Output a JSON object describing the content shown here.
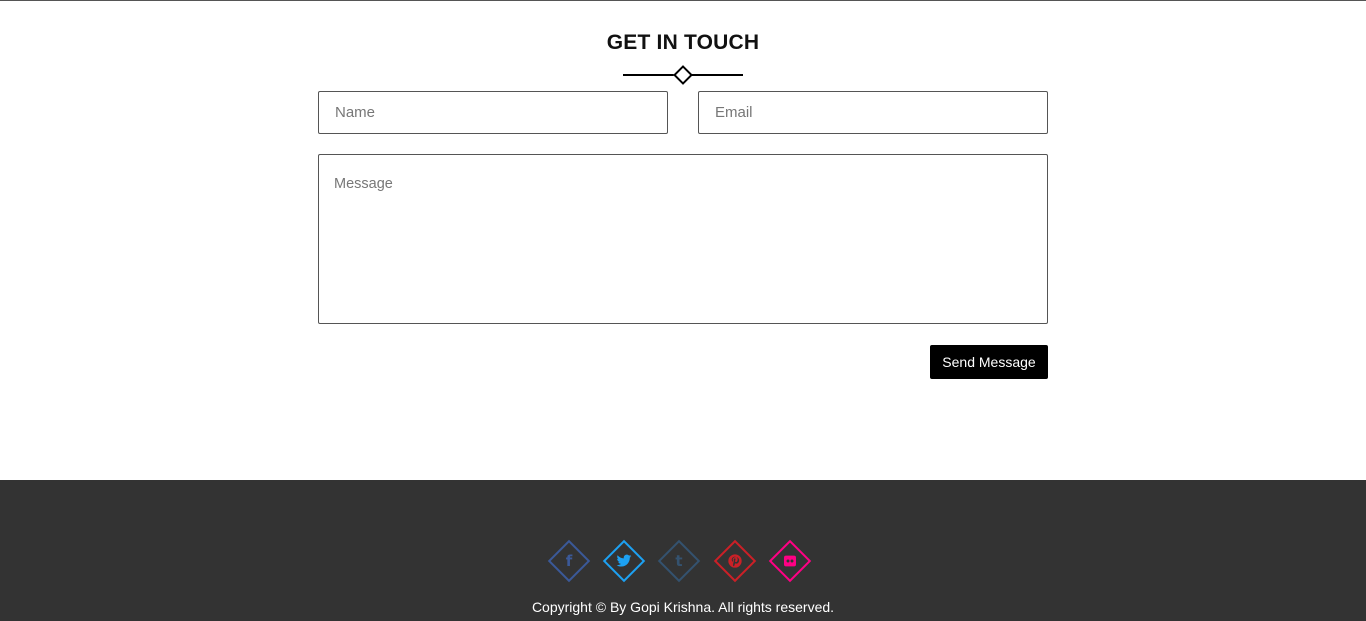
{
  "contact": {
    "title": "GET IN TOUCH",
    "name_placeholder": "Name",
    "email_placeholder": "Email",
    "message_placeholder": "Message",
    "send_label": "Send Message"
  },
  "footer": {
    "socials": [
      {
        "name": "facebook-icon",
        "color": "#3b5998"
      },
      {
        "name": "twitter-icon",
        "color": "#1da1f2"
      },
      {
        "name": "tumblr-icon",
        "color": "#34526f"
      },
      {
        "name": "pinterest-icon",
        "color": "#cb2027"
      },
      {
        "name": "flickr-icon",
        "color": "#ff0084"
      }
    ],
    "copyright": "Copyright © By Gopi Krishna. All rights reserved."
  }
}
